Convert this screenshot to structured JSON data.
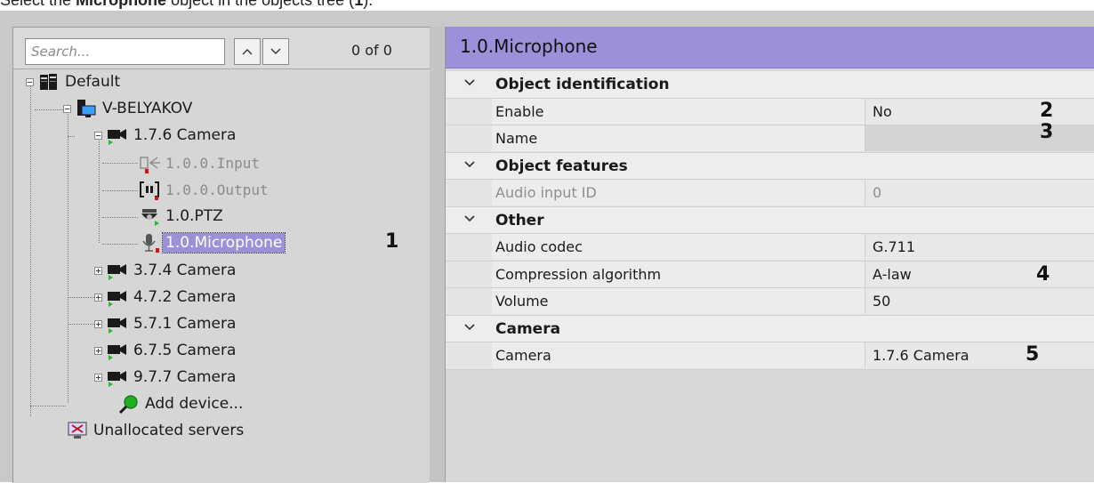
{
  "caption": {
    "before": "Select the ",
    "bold": "Microphone",
    "after": " object in the objects tree (",
    "bold2": "1",
    "end": ")."
  },
  "search": {
    "placeholder": "Search...",
    "counter": "0 of 0"
  },
  "tree": {
    "root": "Default",
    "server": "V-BELYAKOV",
    "camera_open": "1.7.6 Camera",
    "children": [
      "1.0.0.Input",
      "1.0.0.Output",
      "1.0.PTZ",
      "1.0.Microphone"
    ],
    "cameras": [
      "3.7.4 Camera",
      "4.7.2 Camera",
      "5.7.1 Camera",
      "6.7.5 Camera",
      "9.7.7 Camera"
    ],
    "add_device": "Add device...",
    "unallocated": "Unallocated servers"
  },
  "properties": {
    "title": "1.0.Microphone",
    "sections": [
      {
        "name": "Object identification",
        "rows": [
          {
            "key": "Enable",
            "value": "No"
          },
          {
            "key": "Name",
            "value": ""
          }
        ]
      },
      {
        "name": "Object features",
        "rows": [
          {
            "key": "Audio input ID",
            "value": "0"
          }
        ]
      },
      {
        "name": "Other",
        "rows": [
          {
            "key": "Audio codec",
            "value": "G.711"
          },
          {
            "key": "Compression algorithm",
            "value": "A-law"
          },
          {
            "key": "Volume",
            "value": "50"
          }
        ]
      },
      {
        "name": "Camera",
        "rows": [
          {
            "key": "Camera",
            "value": "1.7.6 Camera"
          }
        ]
      }
    ]
  },
  "markers": [
    "1",
    "2",
    "3",
    "4",
    "5"
  ],
  "colors": {
    "accent": "#9c90da",
    "selected": "#9a91d9",
    "status_green": "#2eb82e",
    "status_red": "#e01010"
  }
}
